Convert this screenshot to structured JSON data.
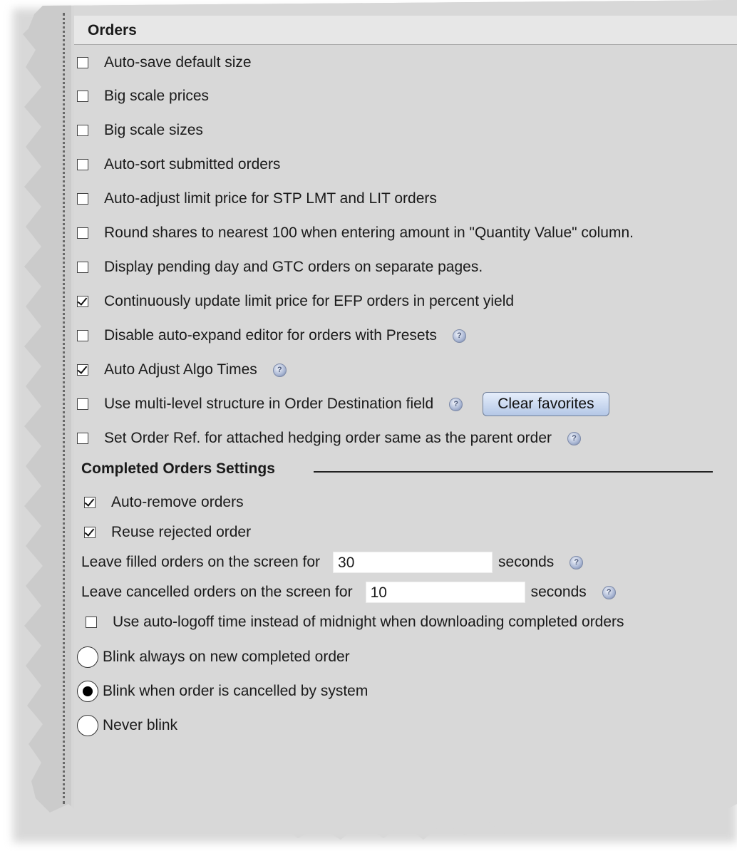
{
  "panel": {
    "title": "Orders"
  },
  "options": [
    {
      "label": "Auto-save default size",
      "checked": false
    },
    {
      "label": "Big scale prices",
      "checked": false
    },
    {
      "label": "Big scale sizes",
      "checked": false
    },
    {
      "label": "Auto-sort submitted orders",
      "checked": false
    },
    {
      "label": "Auto-adjust limit price for STP LMT and LIT orders",
      "checked": false
    },
    {
      "label": "Round shares to nearest 100 when entering amount in \"Quantity Value\" column.",
      "checked": false
    },
    {
      "label": "Display pending day and GTC orders on separate pages.",
      "checked": false
    },
    {
      "label": "Continuously update limit price for EFP orders in percent yield",
      "checked": true
    },
    {
      "label": "Disable auto-expand editor for orders with Presets",
      "checked": false,
      "help": true
    },
    {
      "label": "Auto Adjust Algo Times",
      "checked": true,
      "help": true
    },
    {
      "label": "Use multi-level structure in Order Destination field",
      "checked": false,
      "help": true,
      "button": "Clear favorites"
    },
    {
      "label": "Set Order Ref. for attached hedging order same as the parent order",
      "checked": false,
      "help": true
    }
  ],
  "completed": {
    "title": "Completed Orders Settings",
    "auto_remove": {
      "label": "Auto-remove orders",
      "checked": true
    },
    "reuse_rejected": {
      "label": "Reuse rejected order",
      "checked": true
    },
    "filled": {
      "label": "Leave filled orders on the screen for",
      "value": "30",
      "unit": "seconds"
    },
    "cancelled": {
      "label": "Leave cancelled orders on the screen for",
      "value": "10",
      "unit": "seconds"
    },
    "auto_logoff": {
      "label": "Use auto-logoff time instead of midnight when downloading completed orders",
      "checked": false
    },
    "blink": [
      {
        "label": "Blink always on new completed order",
        "selected": false
      },
      {
        "label": "Blink when order is cancelled by system",
        "selected": true
      },
      {
        "label": "Never blink",
        "selected": false
      }
    ]
  },
  "icons": {
    "help": "help-icon"
  }
}
